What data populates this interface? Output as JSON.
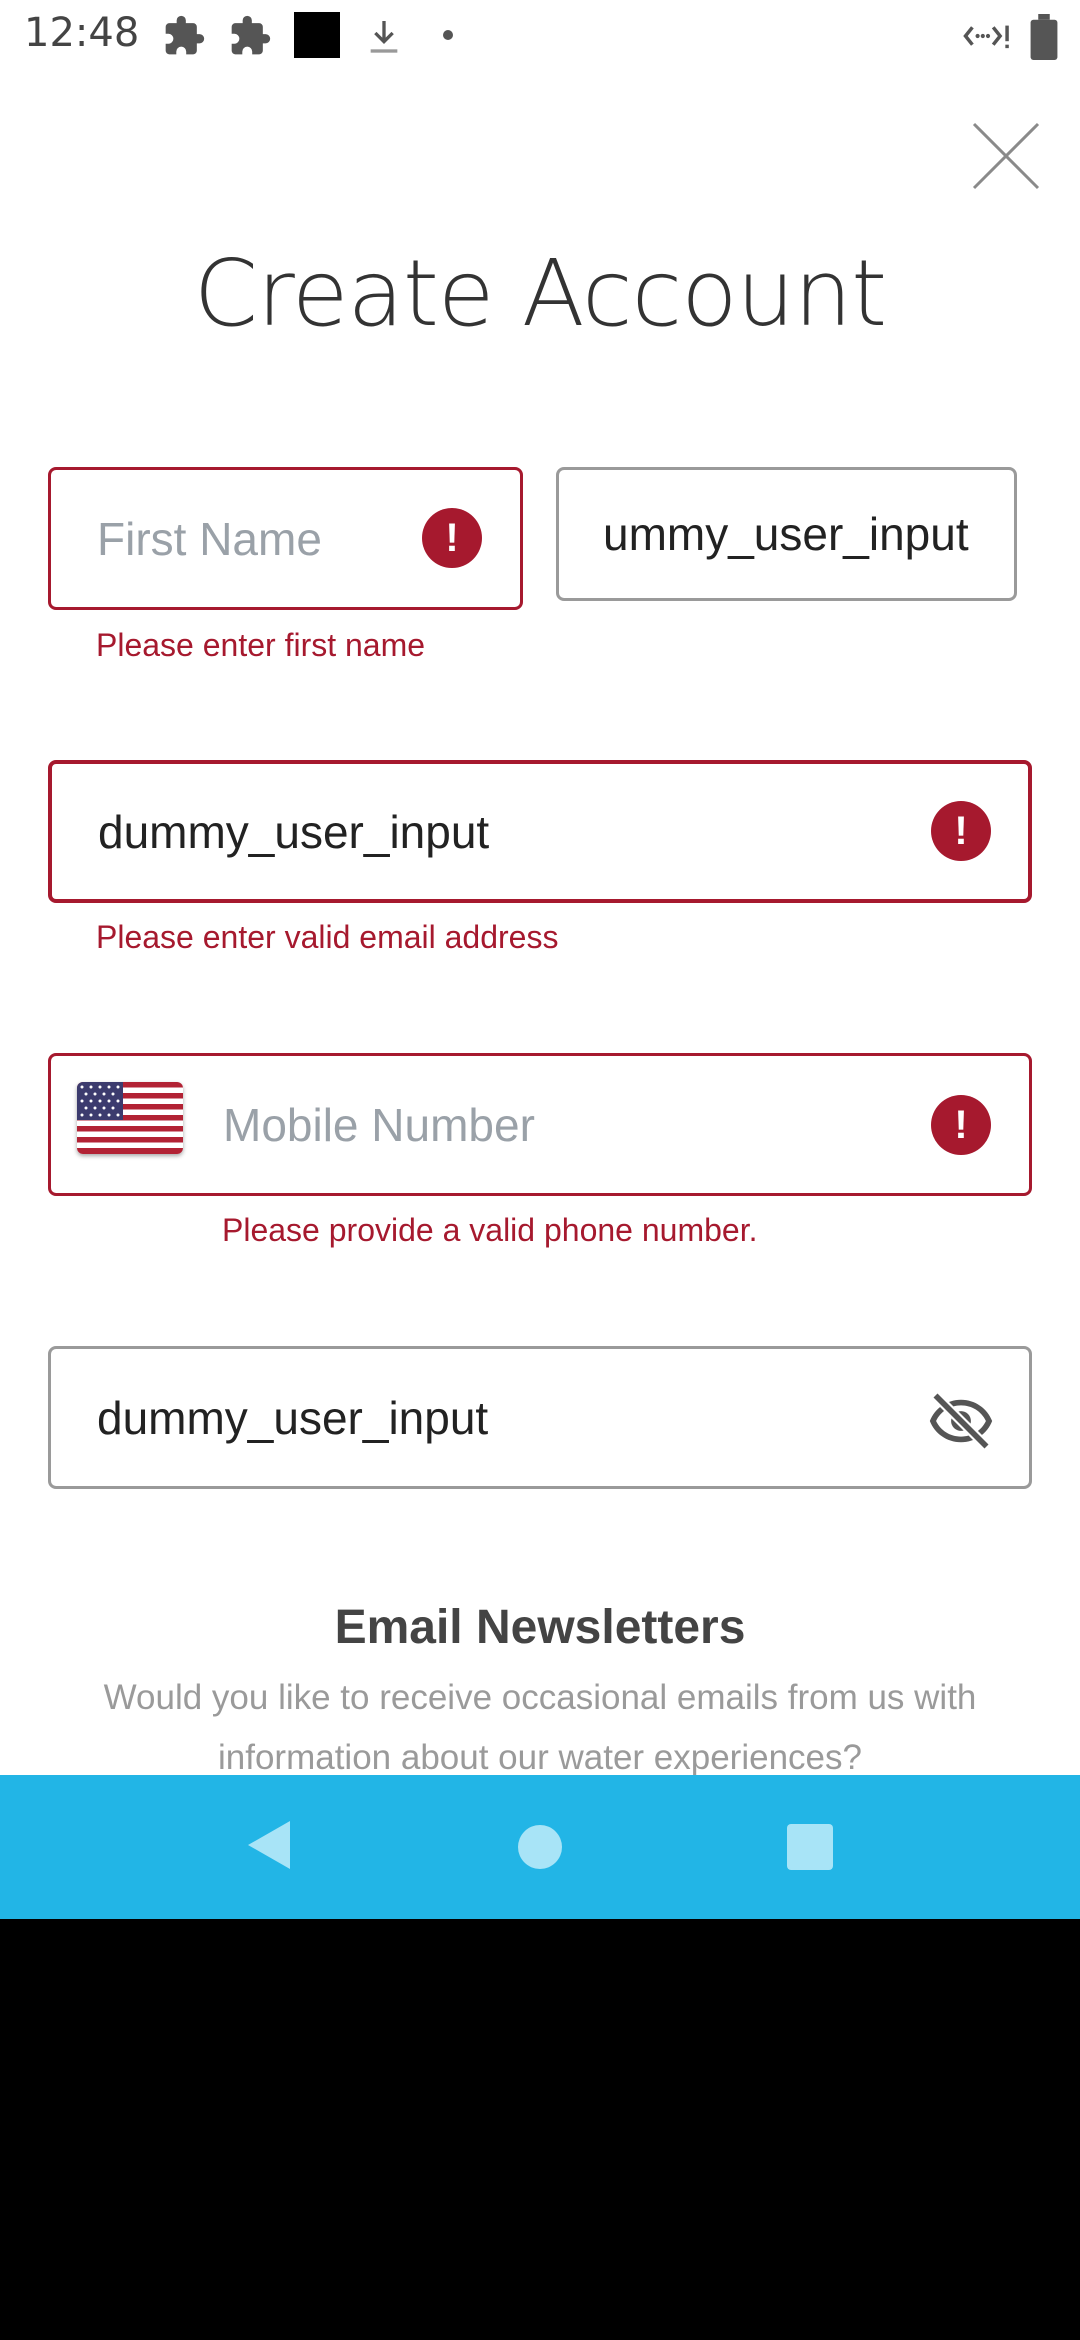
{
  "status_bar": {
    "time": "12:48",
    "icons": [
      "puzzle-icon",
      "puzzle-icon",
      "black-square-icon",
      "download-icon",
      "dot-icon",
      "data-saver-icon",
      "battery-icon"
    ]
  },
  "header": {
    "title": "Create Account",
    "close_icon": "close-icon"
  },
  "form": {
    "first_name": {
      "placeholder": "First Name",
      "value": "",
      "error": "Please enter first name"
    },
    "last_name": {
      "value": "ummy_user_input"
    },
    "email": {
      "value": "dummy_user_input",
      "error": "Please enter valid email address"
    },
    "mobile": {
      "placeholder": "Mobile Number",
      "value": "",
      "country_flag": "us-flag-icon",
      "error": "Please provide a valid phone number."
    },
    "password": {
      "value": "dummy_user_input",
      "toggle_icon": "eye-off-icon"
    }
  },
  "newsletter": {
    "title": "Email Newsletters",
    "description": "Would you like to receive occasional emails from us with information about our water experiences?"
  },
  "nav_bar": {
    "icons": [
      "back-icon",
      "home-icon",
      "recents-icon"
    ]
  },
  "colors": {
    "error": "#a6192e",
    "nav_bar": "#22b5e6",
    "placeholder": "#9aa1a8"
  }
}
